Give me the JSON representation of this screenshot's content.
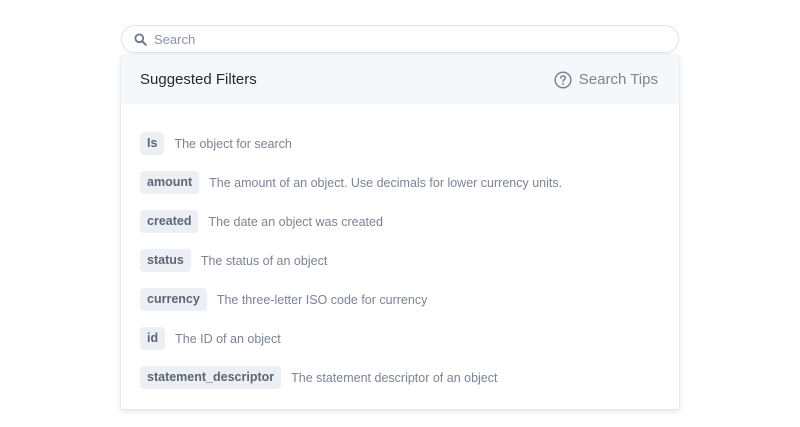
{
  "search": {
    "placeholder": "Search",
    "value": ""
  },
  "panel": {
    "title": "Suggested Filters",
    "tips_label": "Search Tips"
  },
  "filters": [
    {
      "tag": "Is",
      "description": "The object for search"
    },
    {
      "tag": "amount",
      "description": "The amount of an object. Use decimals for lower currency units."
    },
    {
      "tag": "created",
      "description": "The date an object was created"
    },
    {
      "tag": "status",
      "description": "The status of an object"
    },
    {
      "tag": "currency",
      "description": "The three-letter ISO code for currency"
    },
    {
      "tag": "id",
      "description": "The ID of an object"
    },
    {
      "tag": "statement_descriptor",
      "description": "The statement descriptor of an object"
    }
  ],
  "icons": {
    "search": "search-icon",
    "help": "help-circle-icon"
  },
  "colors": {
    "header_bg": "#f5f8fb",
    "tag_bg": "#eceff3",
    "muted_text": "#7b8494",
    "title_text": "#1f2733"
  }
}
